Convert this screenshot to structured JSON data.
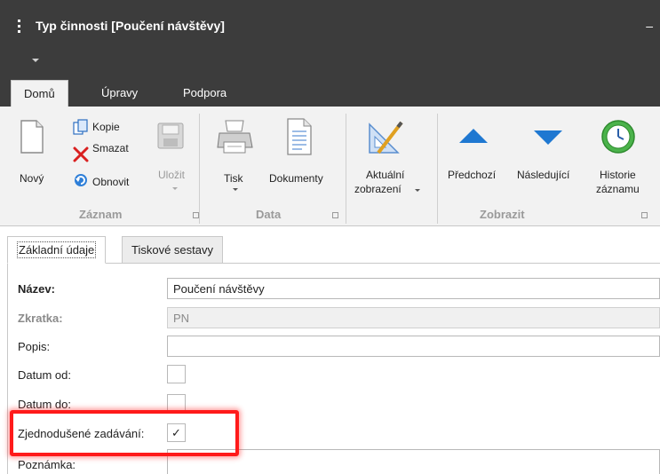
{
  "window": {
    "title": "Typ činnosti [Poučení návštěvy]",
    "close_glyph": "–"
  },
  "ribbon_tabs": [
    {
      "label": "Domů",
      "active": true
    },
    {
      "label": "Úpravy",
      "active": false
    },
    {
      "label": "Podpora",
      "active": false
    }
  ],
  "ribbon": {
    "groups": {
      "zaznam": "Záznam",
      "data": "Data",
      "zobrazit": "Zobrazit"
    },
    "buttons": {
      "novy": "Nový",
      "kopie": "Kopie",
      "smazat": "Smazat",
      "obnovit": "Obnovit",
      "ulozit": "Uložit",
      "tisk": "Tisk",
      "dokumenty": "Dokumenty",
      "aktualni_line1": "Aktuální",
      "aktualni_line2": "zobrazení",
      "predchozi": "Předchozí",
      "nasledujici": "Následující",
      "historie_line1": "Historie",
      "historie_line2": "záznamu"
    },
    "icons": {
      "novy": "new-document-icon",
      "kopie": "copy-icon",
      "smazat": "delete-x-icon",
      "obnovit": "refresh-icon",
      "ulozit": "save-disk-icon",
      "tisk": "printer-icon",
      "dokumenty": "documents-icon",
      "aktualni": "view-settings-icon",
      "predchozi": "arrow-up-icon",
      "nasledujici": "arrow-down-icon",
      "historie": "history-clock-icon"
    },
    "colors": {
      "accent_blue": "#1f78d1",
      "delete_red": "#d92020",
      "history_green": "#3ba53b"
    }
  },
  "content_tabs": [
    {
      "label": "Základní údaje",
      "active": true
    },
    {
      "label": "Tiskové sestavy",
      "active": false
    }
  ],
  "form": {
    "nazev_label": "Název:",
    "nazev_value": "Poučení návštěvy",
    "zkratka_label": "Zkratka:",
    "zkratka_value": "PN",
    "popis_label": "Popis:",
    "popis_value": "",
    "datum_od_label": "Datum od:",
    "datum_do_label": "Datum do:",
    "zjednodusene_label": "Zjednodušené zadávání:",
    "zjednodusene_checked": true,
    "check_glyph": "✓",
    "poznamka_label": "Poznámka:"
  },
  "highlight_color": "#ff1a1a"
}
